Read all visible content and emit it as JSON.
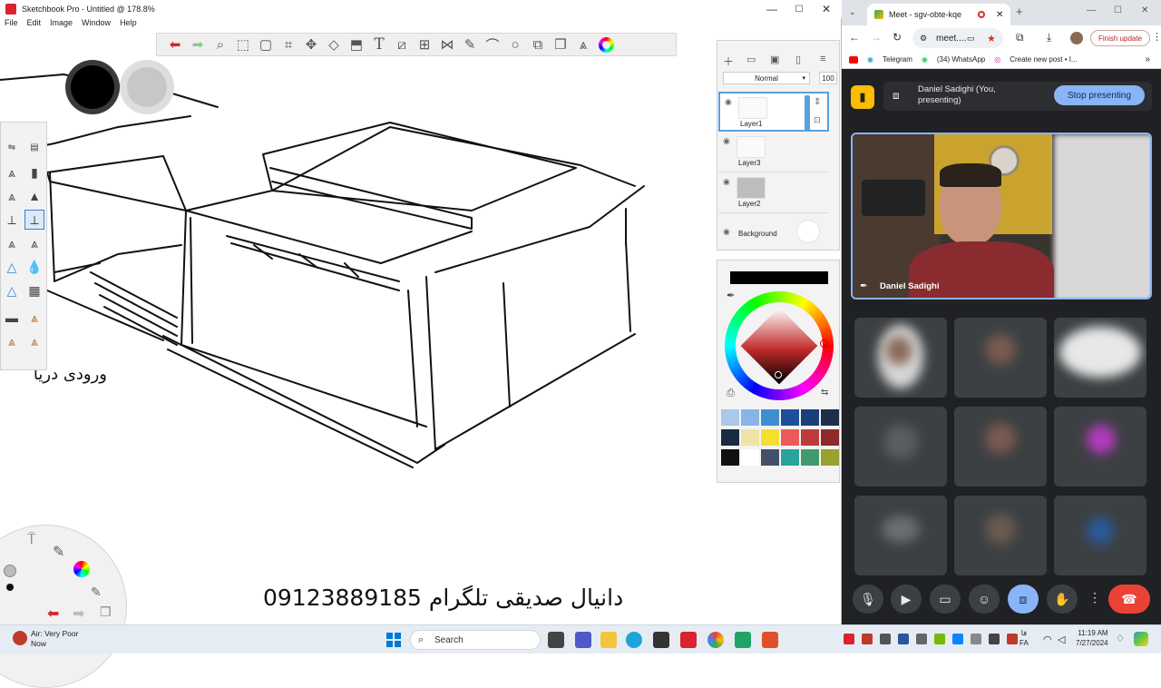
{
  "sketchbook": {
    "title": "Sketchbook Pro - Untitled @ 178.8%",
    "window_controls": {
      "minimize": "—",
      "maximize": "☐",
      "close": "✕"
    },
    "menu": [
      "File",
      "Edit",
      "Image",
      "Window",
      "Help"
    ],
    "toolbar_icons": [
      "undo-icon",
      "redo-icon",
      "zoom-icon",
      "select-icon",
      "transform-select-icon",
      "crop-icon",
      "move-icon",
      "distort-icon",
      "perspective-icon",
      "text-icon",
      "ruler-icon",
      "grid-icon",
      "symmetry-icon",
      "pen-icon",
      "curve-icon",
      "ellipse-icon",
      "shapes-icon",
      "copy-icon",
      "brushes-icon",
      "color-wheel-icon"
    ],
    "canvas_annotation": "ورودی دریا",
    "footer_text": "دانیال صدیقی تلگرام 09123889185",
    "layers": {
      "blend_mode": "Normal",
      "opacity": "100",
      "items": [
        {
          "name": "Layer1",
          "selected": true
        },
        {
          "name": "Layer3",
          "selected": false
        },
        {
          "name": "Layer2",
          "selected": false
        },
        {
          "name": "Background",
          "selected": false
        }
      ]
    },
    "color_swatches": [
      "#a9c9ea",
      "#8ab4e8",
      "#3e8ed0",
      "#1d4f9c",
      "#1b3f7a",
      "#1e2f4a",
      "#1a2a40",
      "#efe3a6",
      "#f4e02b",
      "#ea5a5a",
      "#c0393b",
      "#8f2a2a",
      "#111111",
      "#ffffff",
      "#44506a",
      "#2aa39a",
      "#3f9a6e",
      "#9aa02c"
    ]
  },
  "chrome": {
    "tab_title": "Meet - sgv-obte-kqe",
    "omnibox": "meet....",
    "finish_update": "Finish update",
    "bookmarks": [
      "Telegram",
      "(34) WhatsApp",
      "Create new post • I..."
    ],
    "meet": {
      "presenter_line1": "Daniel Sadighi (You,",
      "presenter_line2": "presenting)",
      "stop_presenting": "Stop presenting",
      "main_video_name": "Daniel Sadighi"
    }
  },
  "taskbar": {
    "notification_title": "Air: Very Poor",
    "notification_sub": "Now",
    "search": "Search",
    "lang_top": "فا",
    "lang_bottom": "FA",
    "time": "11:19 AM",
    "date": "7/27/2024"
  }
}
